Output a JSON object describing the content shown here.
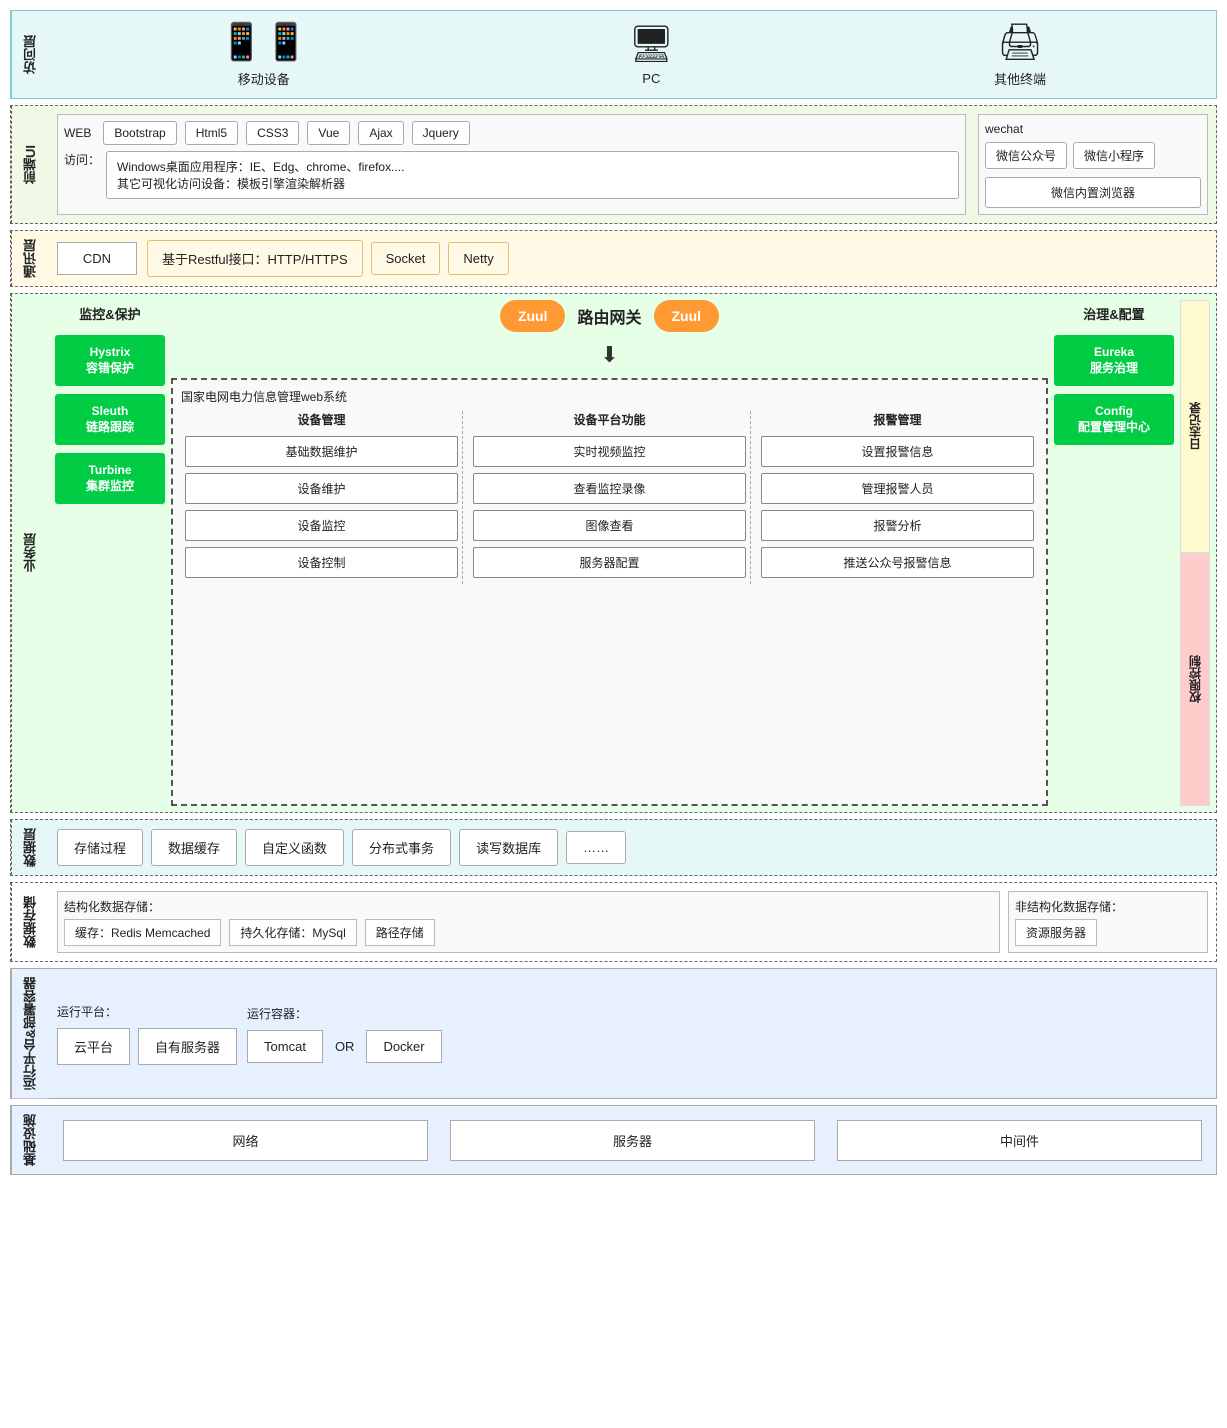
{
  "layers": {
    "access": {
      "label": "访问层",
      "devices": [
        {
          "name": "mobile",
          "icon": "📱",
          "label": "移动设备"
        },
        {
          "name": "pc",
          "icon": "🖥",
          "label": "PC"
        },
        {
          "name": "other",
          "icon": "🖨",
          "label": "其他终端"
        }
      ]
    },
    "frontend": {
      "label": "前端UI",
      "web_label": "WEB",
      "web_techs": [
        "Bootstrap",
        "Html5",
        "CSS3",
        "Vue",
        "Ajax",
        "Jquery"
      ],
      "wechat_label": "wechat",
      "wechat_items": [
        "微信公众号",
        "微信小程序"
      ],
      "access_label": "访问：",
      "access_text": "Windows桌面应用程序：IE、Edg、chrome、firefox....\n其它可视化访问设备：模板引擎渲染解析器",
      "wechat_browser": "微信内置浏览器"
    },
    "comm": {
      "label": "通讯层",
      "cdn": "CDN",
      "restful": "基于Restful接口：HTTP/HTTPS",
      "socket": "Socket",
      "netty": "Netty"
    },
    "business": {
      "label": "业务层",
      "monitor_title": "监控&保护",
      "monitor_items": [
        {
          "name": "Hystrix容错保护",
          "line1": "Hystrix",
          "line2": "容错保护"
        },
        {
          "name": "Sleuth链路跟踪",
          "line1": "Sleuth",
          "line2": "链路跟踪"
        },
        {
          "name": "Turbine集群监控",
          "line1": "Turbine",
          "line2": "集群监控"
        }
      ],
      "gateway_label": "路由网关",
      "zuul": "Zuul",
      "system_title": "国家电网电力信息管理web系统",
      "system_cols": [
        {
          "title": "设备管理",
          "items": [
            "基础数据维护",
            "设备维护",
            "设备监控",
            "设备控制"
          ]
        },
        {
          "title": "设备平台功能",
          "items": [
            "实时视频监控",
            "查看监控录像",
            "图像查看",
            "服务器配置"
          ]
        },
        {
          "title": "报警管理",
          "items": [
            "设置报警信息",
            "管理报警人员",
            "报警分析",
            "推送公众号报警信息"
          ]
        }
      ],
      "govern_title": "治理&配置",
      "govern_items": [
        {
          "name": "Eureka服务治理",
          "line1": "Eureka",
          "line2": "服务治理"
        },
        {
          "name": "Config配置管理中心",
          "line1": "Config",
          "line2": "配置管理中心"
        }
      ],
      "log_label": "日志记录",
      "auth_label": "权限控制"
    },
    "data": {
      "label": "数据层",
      "items": [
        "存储过程",
        "数据缓存",
        "自定义函数",
        "分布式事务",
        "读写数据库",
        "……"
      ]
    },
    "storage": {
      "label": "数据存储",
      "structured_title": "结构化数据存储：",
      "cache_label": "缓存：Redis  Memcached",
      "persist_label": "持久化存储：MySql",
      "path_label": "路径存储",
      "unstructured_title": "非结构化数据存储：",
      "resource_label": "资源服务器"
    },
    "runtime": {
      "label": "运行平台&部署容器",
      "platform_title": "运行平台：",
      "platform_items": [
        "云平台",
        "自有服务器"
      ],
      "container_title": "运行容器：",
      "container_items": [
        "Tomcat",
        "OR",
        "Docker"
      ]
    },
    "infra": {
      "label": "基础设施",
      "items": [
        "网络",
        "服务器",
        "中间件"
      ]
    }
  }
}
